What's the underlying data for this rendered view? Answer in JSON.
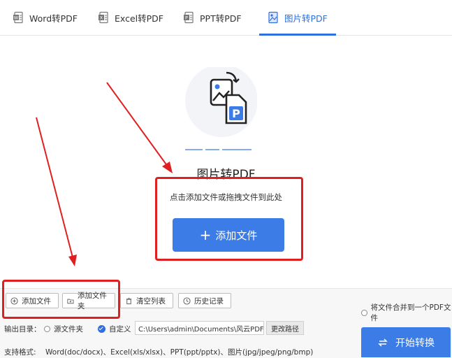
{
  "tabs": [
    {
      "label": "Word转PDF",
      "icon": "word-doc-icon"
    },
    {
      "label": "Excel转PDF",
      "icon": "excel-doc-icon"
    },
    {
      "label": "PPT转PDF",
      "icon": "ppt-doc-icon"
    },
    {
      "label": "图片转PDF",
      "icon": "image-doc-icon",
      "active": true
    }
  ],
  "main": {
    "title": "图片转PDF",
    "hint": "点击添加文件或拖拽文件到此处",
    "add_button": "添加文件"
  },
  "toolbar": {
    "add_file": "添加文件",
    "add_folder": "添加文件夹",
    "clear_list": "清空列表",
    "history": "历史记录",
    "merge_label": "将文件合并到一个PDF文件"
  },
  "output": {
    "label": "输出目录：",
    "source_folder": "源文件夹",
    "custom": "自定义",
    "path": "C:\\Users\\admin\\Documents\\风云PDF...",
    "change_path": "更改路径"
  },
  "formats": {
    "label": "支持格式:",
    "value": "Word(doc/docx)、Excel(xls/xlsx)、PPT(ppt/pptx)、图片(jpg/jpeg/png/bmp)"
  },
  "start_button": "开始转换",
  "colors": {
    "accent": "#3b7ce6",
    "annotation": "#e02020"
  }
}
